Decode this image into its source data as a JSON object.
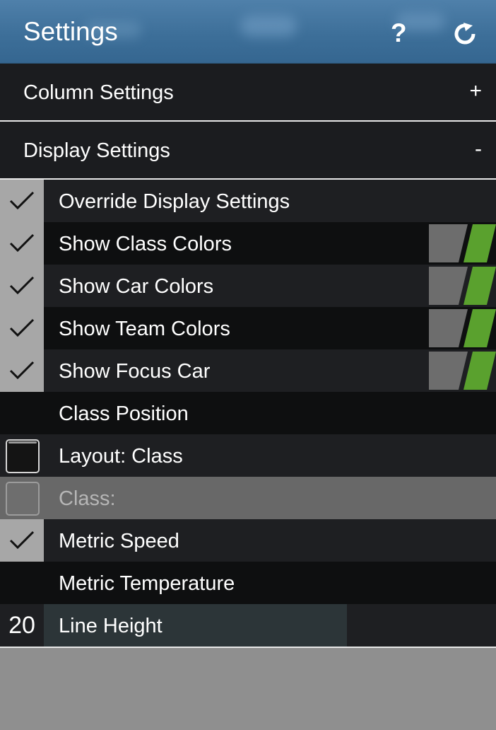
{
  "header": {
    "title": "Settings",
    "help_label": "?",
    "refresh_label": "↻"
  },
  "sections": [
    {
      "label": "Column Settings",
      "sign": "+"
    },
    {
      "label": "Display Settings",
      "sign": "-"
    }
  ],
  "rows": [
    {
      "label": "Override Display Settings",
      "checked": true
    },
    {
      "label": "Show Class Colors",
      "checked": true,
      "swatch": true
    },
    {
      "label": "Show Car Colors",
      "checked": true,
      "swatch": true
    },
    {
      "label": "Show Team Colors",
      "checked": true,
      "swatch": true
    },
    {
      "label": "Show Focus Car",
      "checked": true,
      "swatch": true
    },
    {
      "label": "Class Position",
      "checked": false
    },
    {
      "label": "Layout: Class",
      "checked": false
    },
    {
      "label": "Class:",
      "checked": false,
      "disabled": true
    },
    {
      "label": "Metric Speed",
      "checked": true
    },
    {
      "label": "Metric Temperature",
      "checked": false
    }
  ],
  "line_height": {
    "value": "20",
    "label": "Line Height"
  },
  "colors": {
    "accent_green": "#5aa12e",
    "swatch_grey": "#6d6d6d",
    "header_blue": "#3d6f99"
  }
}
